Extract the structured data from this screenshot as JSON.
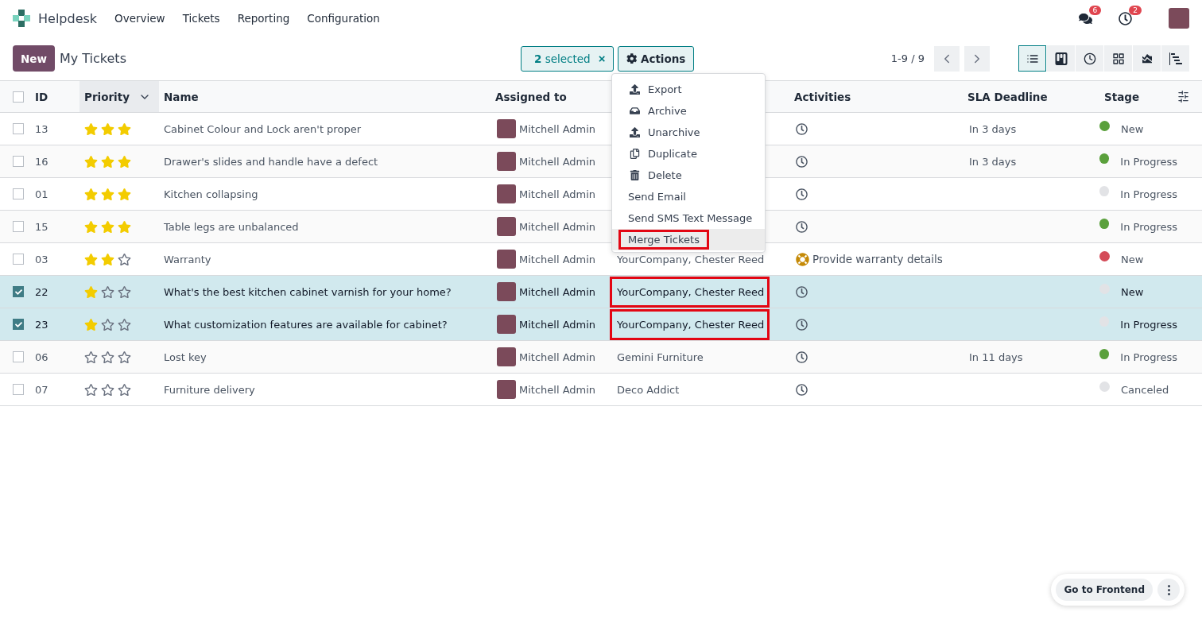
{
  "navbar": {
    "app": "Helpdesk",
    "menus": [
      "Overview",
      "Tickets",
      "Reporting",
      "Configuration"
    ],
    "messages_badge": "6",
    "activities_badge": "2"
  },
  "control_panel": {
    "new_button": "New",
    "title": "My Tickets",
    "selection": {
      "count": "2",
      "label": "selected",
      "clear": "×"
    },
    "actions_button": "Actions",
    "pager": "1-9 / 9",
    "views": [
      {
        "kind": "list",
        "selected": true
      },
      {
        "kind": "kanban",
        "selected": false
      },
      {
        "kind": "activity",
        "selected": false
      },
      {
        "kind": "pivot",
        "selected": false
      },
      {
        "kind": "graph",
        "selected": false
      },
      {
        "kind": "cohort",
        "selected": false
      }
    ]
  },
  "actions_menu": [
    {
      "label": "Export",
      "kind": "export",
      "highlighted": false
    },
    {
      "label": "Archive",
      "kind": "archive",
      "highlighted": false
    },
    {
      "label": "Unarchive",
      "kind": "unarchive",
      "highlighted": false
    },
    {
      "label": "Duplicate",
      "kind": "duplicate",
      "highlighted": false
    },
    {
      "label": "Delete",
      "kind": "delete",
      "highlighted": false
    },
    {
      "label": "Send Email",
      "kind": "plain",
      "highlighted": false
    },
    {
      "label": "Send SMS Text Message",
      "kind": "plain",
      "highlighted": false
    },
    {
      "label": "Merge Tickets",
      "kind": "plain",
      "highlighted": true
    }
  ],
  "table": {
    "all_checked": false,
    "columns": [
      "ID",
      "Priority",
      "Name",
      "Assigned to",
      "Activities",
      "SLA Deadline",
      "Stage"
    ],
    "rows": [
      {
        "id": "13",
        "stars": 3,
        "name": "Cabinet Colour and Lock aren't proper",
        "assigned": "Mitchell Admin",
        "sla": "In 3 days",
        "stage": "New",
        "color": "#5aa03c",
        "selected": false
      },
      {
        "id": "16",
        "stars": 3,
        "name": "Drawer's slides and handle have a defect",
        "assigned": "Mitchell Admin",
        "sla": "In 3 days",
        "stage": "In Progress",
        "color": "#5aa03c",
        "selected": false
      },
      {
        "id": "01",
        "stars": 3,
        "name": "Kitchen collapsing",
        "assigned": "Mitchell Admin",
        "stage": "In Progress",
        "color": "#e2e3e6",
        "selected": false
      },
      {
        "id": "15",
        "stars": 3,
        "name": "Table legs are unbalanced",
        "assigned": "Mitchell Admin",
        "stage": "In Progress",
        "color": "#5aa03c",
        "selected": false
      },
      {
        "id": "03",
        "stars": 2,
        "name": "Warranty",
        "assigned": "Mitchell Admin",
        "customer": "YourCompany, Chester Reed",
        "activity": "Provide warranty details",
        "stage": "New",
        "color": "#d44c59",
        "selected": false
      },
      {
        "id": "22",
        "stars": 1,
        "name": "What's the best kitchen cabinet varnish for your home?",
        "assigned": "Mitchell Admin",
        "customer": "YourCompany, Chester Reed",
        "stage": "New",
        "color": "#e2e3e6",
        "selected": true,
        "highlighted": true
      },
      {
        "id": "23",
        "stars": 1,
        "name": "What customization features are available for cabinet?",
        "assigned": "Mitchell Admin",
        "customer": "YourCompany, Chester Reed",
        "stage": "In Progress",
        "color": "#e2e3e6",
        "selected": true,
        "highlighted": true
      },
      {
        "id": "06",
        "stars": 0,
        "name": "Lost key",
        "assigned": "Mitchell Admin",
        "customer": "Gemini Furniture",
        "sla": "In 11 days",
        "stage": "In Progress",
        "color": "#5aa03c",
        "selected": false
      },
      {
        "id": "07",
        "stars": 0,
        "name": "Furniture delivery",
        "assigned": "Mitchell Admin",
        "customer": "Deco Addict",
        "stage": "Canceled",
        "color": "#e2e3e6",
        "selected": false
      }
    ]
  },
  "frontend_button": "Go to Frontend"
}
